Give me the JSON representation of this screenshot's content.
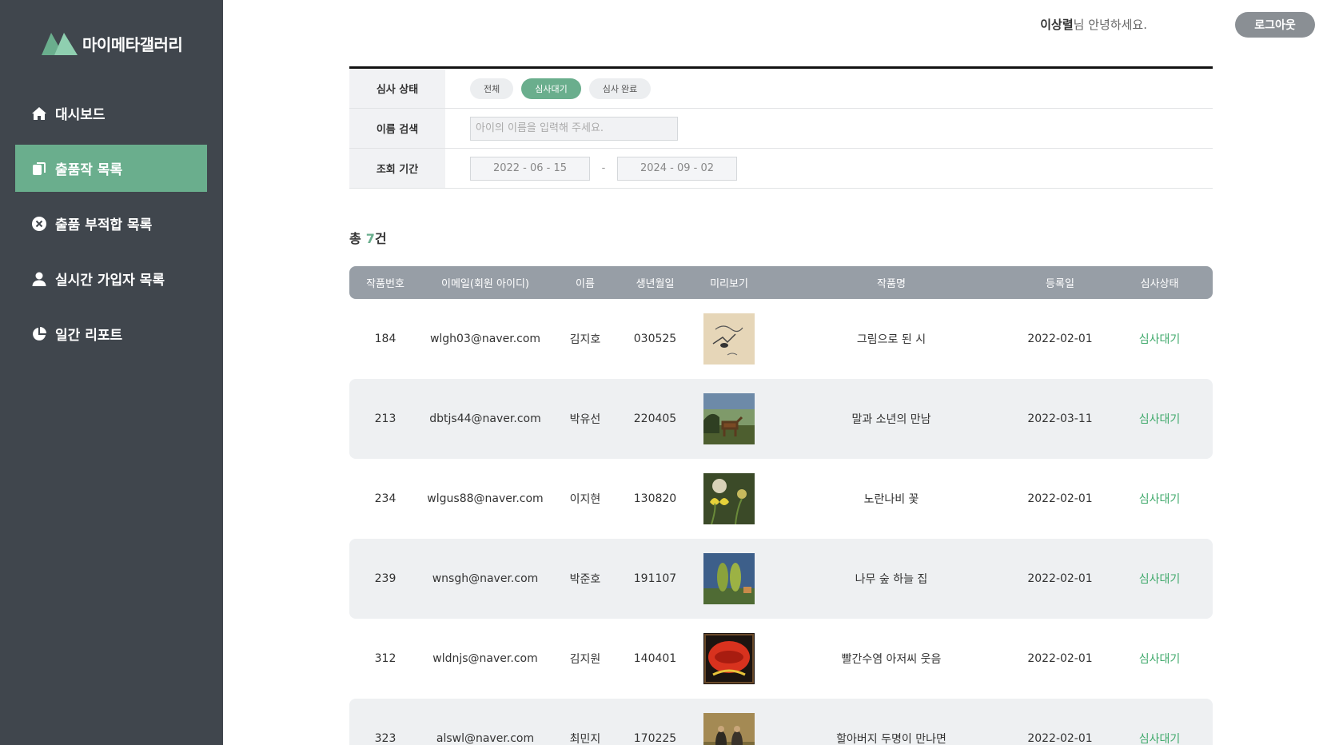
{
  "sidebar": {
    "logo_text": "마이메타갤러리",
    "items": [
      {
        "label": "대시보드",
        "icon": "home-icon",
        "active": false
      },
      {
        "label": "출품작 목록",
        "icon": "copy-icon",
        "active": true
      },
      {
        "label": "출품 부적합 목록",
        "icon": "close-circle-icon",
        "active": false
      },
      {
        "label": "실시간 가입자 목록",
        "icon": "user-icon",
        "active": false
      },
      {
        "label": "일간 리포트",
        "icon": "pie-chart-icon",
        "active": false
      }
    ]
  },
  "header": {
    "user_name": "이상렬",
    "greeting_suffix": "님 안녕하세요.",
    "logout_label": "로그아웃"
  },
  "filter": {
    "status_label": "심사 상태",
    "status_options": [
      "전체",
      "심사대기",
      "심사 완료"
    ],
    "status_selected": "심사대기",
    "name_label": "이름 검색",
    "name_placeholder": "아이의 이름을 입력해 주세요.",
    "period_label": "조회 기간",
    "start_date": "2022 - 06 - 15",
    "date_separator": "-",
    "end_date": "2024 - 09 - 02"
  },
  "summary": {
    "prefix": "총",
    "count": "7",
    "suffix": "건"
  },
  "table": {
    "columns": [
      "작품번호",
      "이메일(회원 아이디)",
      "이름",
      "생년월일",
      "미리보기",
      "작품명",
      "등록일",
      "심사상태"
    ],
    "rows": [
      {
        "id": "184",
        "email": "wlgh03@naver.com",
        "name": "김지호",
        "birth": "030525",
        "title": "그림으로 된 시",
        "date": "2022-02-01",
        "status": "심사대기",
        "thumb": "sketch"
      },
      {
        "id": "213",
        "email": "dbtjs44@naver.com",
        "name": "박유선",
        "birth": "220405",
        "title": "말과 소년의 만남",
        "date": "2022-03-11",
        "status": "심사대기",
        "thumb": "horse"
      },
      {
        "id": "234",
        "email": "wlgus88@naver.com",
        "name": "이지현",
        "birth": "130820",
        "title": "노란나비 꽃",
        "date": "2022-02-01",
        "status": "심사대기",
        "thumb": "butterfly"
      },
      {
        "id": "239",
        "email": "wnsgh@naver.com",
        "name": "박준호",
        "birth": "191107",
        "title": "나무 숲 하늘 집",
        "date": "2022-02-01",
        "status": "심사대기",
        "thumb": "trees"
      },
      {
        "id": "312",
        "email": "wldnjs@naver.com",
        "name": "김지원",
        "birth": "140401",
        "title": "빨간수염 아저씨 웃음",
        "date": "2022-02-01",
        "status": "심사대기",
        "thumb": "poster"
      },
      {
        "id": "323",
        "email": "alswl@naver.com",
        "name": "최민지",
        "birth": "170225",
        "title": "할아버지 두명이 만나면",
        "date": "2022-02-01",
        "status": "심사대기",
        "thumb": "oldmen"
      }
    ]
  },
  "colors": {
    "accent": "#6aae8d",
    "sidebar": "#40464d",
    "status": "#3fa96b"
  }
}
